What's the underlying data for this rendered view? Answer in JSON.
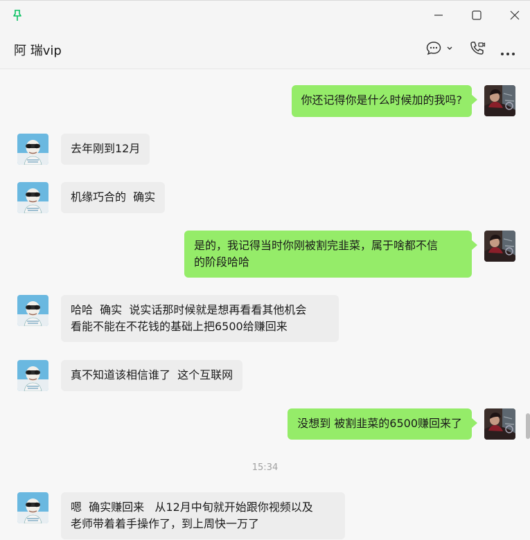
{
  "window": {
    "pin_icon": "pin-icon",
    "minimize_icon": "minimize-icon",
    "maximize_icon": "maximize-icon",
    "close_icon": "close-icon"
  },
  "header": {
    "contact_name": "阿 瑞vip",
    "chat_icon": "chat-bubble-icon",
    "call_icon": "video-call-icon",
    "more_icon": "more-icon"
  },
  "colors": {
    "outgoing_bubble": "#95ec69",
    "incoming_bubble": "#ededed",
    "pin_accent": "#07c160"
  },
  "messages": [
    {
      "side": "out",
      "text": "你还记得你是什么时候加的我吗?"
    },
    {
      "side": "in",
      "text": "去年刚到12月"
    },
    {
      "side": "in",
      "text": "机缘巧合的  确实"
    },
    {
      "side": "out",
      "text": "是的，我记得当时你刚被割完韭菜，属于啥都不信\n的阶段哈哈"
    },
    {
      "side": "in",
      "text": "哈哈  确实  说实话那时候就是想再看看其他机会\n看能不能在不花钱的基础上把6500给赚回来"
    },
    {
      "side": "in",
      "text": "真不知道该相信谁了  这个互联网"
    },
    {
      "side": "out",
      "text": "没想到 被割韭菜的6500赚回来了"
    },
    {
      "side": "in",
      "text": "嗯  确实赚回来   从12月中旬就开始跟你视频以及\n老师带着着手操作了，到上周快一万了"
    }
  ],
  "timestamp": "15:34"
}
